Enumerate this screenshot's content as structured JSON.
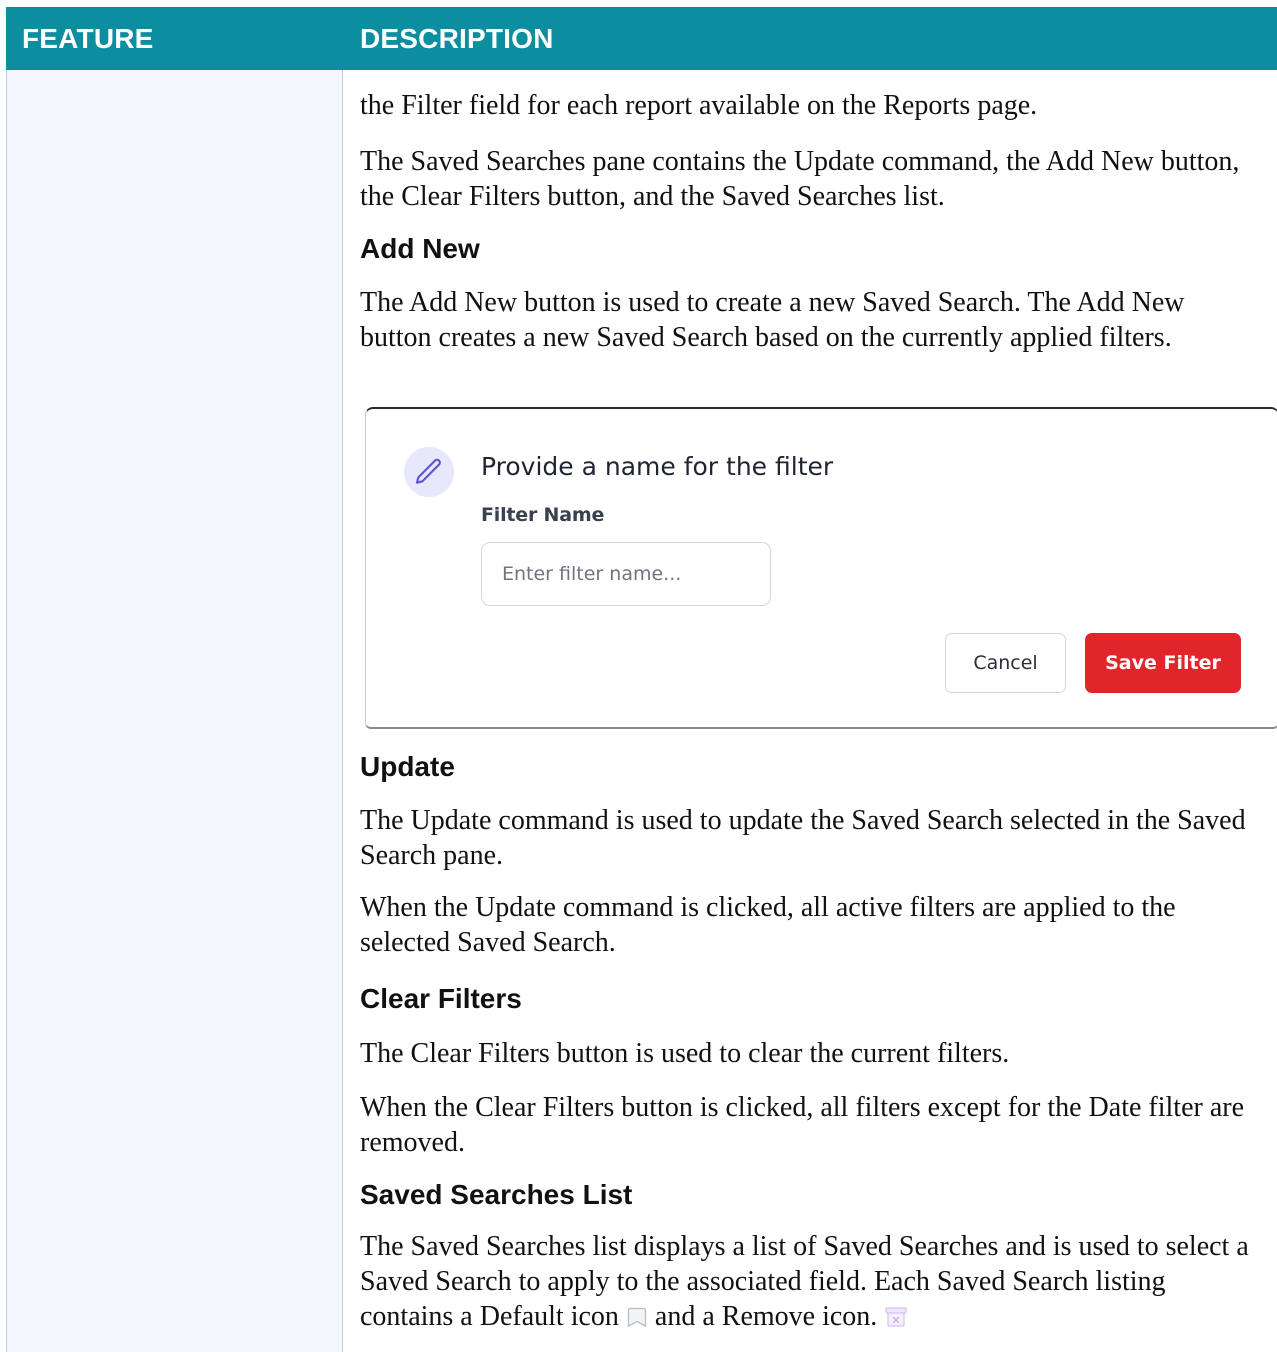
{
  "header": {
    "feature": "FEATURE",
    "description": "DESCRIPTION"
  },
  "content": {
    "p_intro": "the Filter field for each report available on the Reports page.",
    "p_pane": "The Saved Searches pane contains the Update command, the Add New button, the Clear Filters button, and the Saved Searches list.",
    "add_new": {
      "heading": "Add New",
      "text": "The Add New button is used to create a new Saved Search. The Add New button creates a new Saved Search based on the currently applied filters."
    },
    "dialog": {
      "title": "Provide a name for the filter",
      "field_label": "Filter Name",
      "input_value": "",
      "input_placeholder": "Enter filter name...",
      "cancel_label": "Cancel",
      "save_label": "Save Filter",
      "icon": "pencil-icon",
      "accent_color": "#e0262a"
    },
    "update": {
      "heading": "Update",
      "text1": "The Update command is used to update the Saved Search selected in the Saved Search pane.",
      "text2": "When the Update command is clicked, all active filters are applied to the selected Saved Search."
    },
    "clear_filters": {
      "heading": "Clear Filters",
      "text1": "The Clear Filters button is used to clear the current filters.",
      "text2": "When the Clear Filters button is clicked, all filters except for the Date filter are removed."
    },
    "saved_list": {
      "heading": "Saved Searches List",
      "text_a": "The Saved Searches list displays a list of Saved Searches and is used to select a Saved Search to apply to the associated field. Each Saved Search listing contains a Default icon",
      "text_b": " and a Remove icon.",
      "default_icon": "bookmark-icon",
      "remove_icon": "archive-icon"
    }
  },
  "colors": {
    "header_bg": "#0c8ea0",
    "feature_bg": "#f1f7fc"
  }
}
